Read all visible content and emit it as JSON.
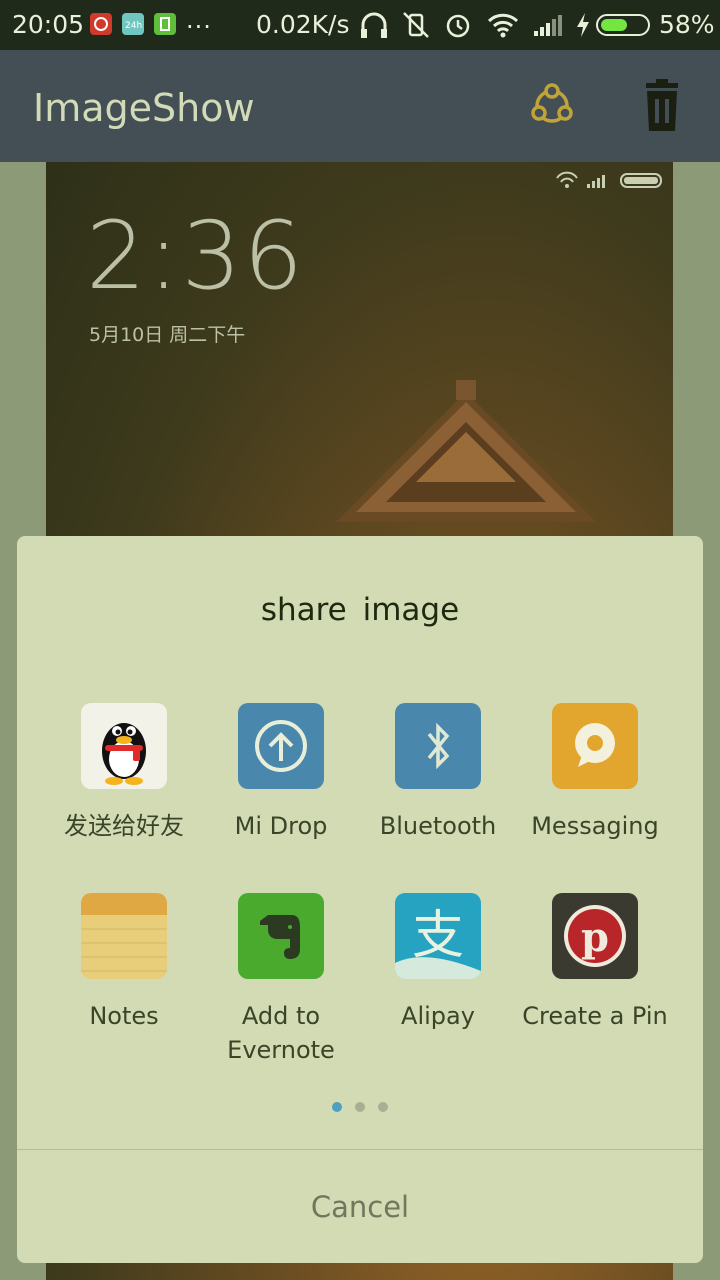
{
  "status_bar": {
    "time": "20:05",
    "overflow": "...",
    "net_speed": "0.02K/s",
    "battery_percent": "58%",
    "battery_level": 0.58,
    "icons": [
      "netease-music-icon",
      "24h-icon",
      "battery-saver-icon",
      "headphones-icon",
      "vibrate-off-icon",
      "alarm-icon",
      "wifi-icon",
      "signal-icon",
      "charging-icon"
    ]
  },
  "app_bar": {
    "title": "ImageShow",
    "share_icon": "share-icon",
    "delete_icon": "trash-icon"
  },
  "image": {
    "lock_time": "2:36",
    "lock_date": "5月10日  周二下午"
  },
  "dialog": {
    "title": "share image",
    "items": [
      {
        "label": "发送给好友",
        "icon": "qq-icon"
      },
      {
        "label": "Mi Drop",
        "icon": "mi-drop-icon"
      },
      {
        "label": "Bluetooth",
        "icon": "bluetooth-icon"
      },
      {
        "label": "Messaging",
        "icon": "messaging-icon"
      },
      {
        "label": "Notes",
        "icon": "notes-icon"
      },
      {
        "label": "Add to Evernote",
        "icon": "evernote-icon"
      },
      {
        "label": "Alipay",
        "icon": "alipay-icon"
      },
      {
        "label": "Create a Pin",
        "icon": "pinterest-icon"
      }
    ],
    "page_count": 3,
    "current_page": 1,
    "cancel_label": "Cancel"
  },
  "colors": {
    "app_bar": "#434f55",
    "dialog_bg": "#d3dbb5",
    "accent": "#4f9fc0",
    "share_icon": "#c0a43a"
  }
}
